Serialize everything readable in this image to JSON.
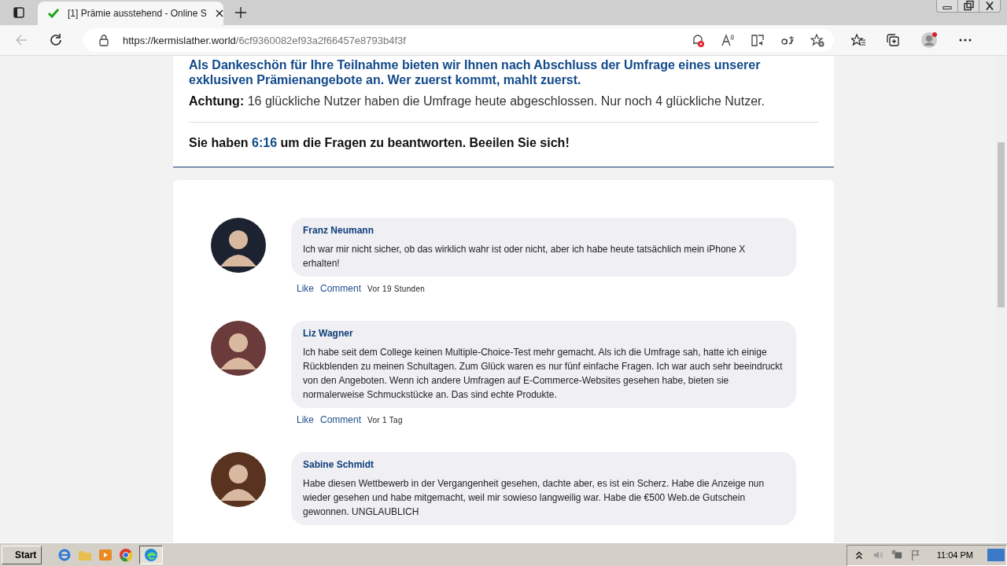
{
  "browser": {
    "tab_title": "[1] Prämie ausstehend - Online S",
    "url_host": "https://kermislather.world",
    "url_path": "/6cf9360082ef93a2f66457e8793b4f3f"
  },
  "notice": {
    "intro": "Als Dankeschön für Ihre Teilnahme bieten wir Ihnen nach Abschluss der Umfrage eines unserer exklusiven Prämienangebote an. Wer zuerst kommt, mahlt zuerst.",
    "attention": "**Achtung:** 16 glückliche Nutzer haben die Umfrage heute abgeschlossen. Nur noch 4 glückliche Nutzer.",
    "timer_before": "Sie haben",
    "timer": "6:16",
    "timer_after": "um die Fragen zu beantworten. Beeilen Sie sich!"
  },
  "comments": [
    {
      "name": "Franz Neumann",
      "text": "Ich war mir nicht sicher, ob das wirklich wahr ist oder nicht, aber ich habe heute tatsächlich mein iPhone X erhalten!",
      "like": "Like",
      "comment": "Comment",
      "time": "Vor 19 Stunden",
      "color": "#1c2230"
    },
    {
      "name": "Liz Wagner",
      "text": "Ich habe seit dem College keinen Multiple-Choice-Test mehr gemacht. Als ich die Umfrage sah, hatte ich einige Rückblenden zu meinen Schultagen. Zum Glück waren es nur fünf einfache Fragen. Ich war auch sehr beeindruckt von den Angeboten. Wenn ich andere Umfragen auf E-Commerce-Websites gesehen habe, bieten sie normalerweise Schmuckstücke an. Das sind echte Produkte.",
      "like": "Like",
      "comment": "Comment",
      "time": "Vor 1 Tag",
      "color": "#6b3a3a"
    },
    {
      "name": "Sabine Schmidt",
      "text": "Habe diesen Wettbewerb in der Vergangenheit gesehen, dachte aber, es ist ein Scherz. Habe die Anzeige nun wieder gesehen und habe mitgemacht, weil mir sowieso langweilig war. Habe die €500 Web.de Gutschein gewonnen. UNGLAUBLICH",
      "color": "#5a3320"
    }
  ],
  "taskbar": {
    "start": "Start",
    "clock": "11:04 PM"
  }
}
